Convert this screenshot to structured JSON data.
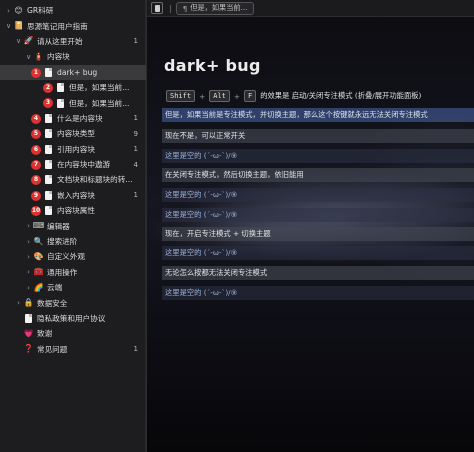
{
  "sidebar": {
    "items": [
      {
        "label": "GR科研",
        "count": "",
        "icon": "smile-emoji-icon",
        "glyph": "😊",
        "twisty": "chevron-right"
      },
      {
        "label": "思源笔记用户指南",
        "count": "",
        "icon": "book-icon",
        "glyph": "📔",
        "twisty": "chevron-down"
      },
      {
        "label": "请从这里开始",
        "count": "1",
        "icon": "rocket-icon",
        "glyph": "🚀",
        "twisty": "chevron-down"
      },
      {
        "label": "内容块",
        "count": "",
        "icon": "fire-extinguisher-icon",
        "glyph": "🧯",
        "twisty": "chevron-down"
      },
      {
        "label": "dark+ bug",
        "count": "",
        "icon": "document-icon",
        "glyph": "",
        "twisty": "chevron-down",
        "badge": "1"
      },
      {
        "label": "但是，如果当前...",
        "count": "",
        "icon": "document-icon",
        "glyph": "",
        "twisty": "",
        "badge": "2"
      },
      {
        "label": "但是，如果当前...",
        "count": "",
        "icon": "document-icon",
        "glyph": "",
        "twisty": "",
        "badge": "3"
      },
      {
        "label": "什么是内容块",
        "count": "1",
        "icon": "document-icon",
        "glyph": "",
        "twisty": "",
        "badge": "4"
      },
      {
        "label": "内容块类型",
        "count": "9",
        "icon": "document-icon",
        "glyph": "",
        "twisty": "",
        "badge": "5"
      },
      {
        "label": "引用内容块",
        "count": "1",
        "icon": "document-icon",
        "glyph": "",
        "twisty": "",
        "badge": "6"
      },
      {
        "label": "在内容块中遨游",
        "count": "4",
        "icon": "document-icon",
        "glyph": "",
        "twisty": "",
        "badge": "7"
      },
      {
        "label": "文档块和标题块的转...",
        "count": "",
        "icon": "document-icon",
        "glyph": "",
        "twisty": "",
        "badge": "8"
      },
      {
        "label": "嵌入内容块",
        "count": "1",
        "icon": "document-icon",
        "glyph": "",
        "twisty": "",
        "badge": "9"
      },
      {
        "label": "内容块属性",
        "count": "",
        "icon": "document-icon",
        "glyph": "",
        "twisty": "",
        "badge": "10"
      },
      {
        "label": "编辑器",
        "count": "",
        "icon": "keyboard-icon",
        "glyph": "⌨",
        "twisty": "chevron-right"
      },
      {
        "label": "搜索进阶",
        "count": "",
        "icon": "magnifier-icon",
        "glyph": "🔍",
        "twisty": "chevron-right"
      },
      {
        "label": "自定义外观",
        "count": "",
        "icon": "palette-icon",
        "glyph": "🎨",
        "twisty": "chevron-right"
      },
      {
        "label": "通用操作",
        "count": "",
        "icon": "toolbox-icon",
        "glyph": "🧰",
        "twisty": "chevron-right"
      },
      {
        "label": "云端",
        "count": "",
        "icon": "rainbow-icon",
        "glyph": "🌈",
        "twisty": "chevron-right"
      },
      {
        "label": "数据安全",
        "count": "",
        "icon": "lock-icon",
        "glyph": "🔒",
        "twisty": "chevron-right"
      },
      {
        "label": "隐私政策和用户协议",
        "count": "",
        "icon": "document-icon",
        "glyph": "",
        "twisty": ""
      },
      {
        "label": "致谢",
        "count": "",
        "icon": "heart-icon",
        "glyph": "💗",
        "twisty": ""
      },
      {
        "label": "常见问题",
        "count": "1",
        "icon": "question-icon",
        "glyph": "❓",
        "twisty": ""
      }
    ]
  },
  "tabbar": {
    "separator": "|",
    "tab_label": "但是，如果当前...",
    "tab_prefix": "¶"
  },
  "doc": {
    "title": "dark+  bug",
    "keys": [
      "Shift",
      "Alt",
      "F"
    ],
    "shortcut_plus": "+",
    "shortcut_text": "的效果是 启动/关闭专注模式 (折叠/展开功能面板)",
    "paragraphs": [
      "但是，如果当前是专注模式，并切换主题，那么这个按键就永远无法关闭专注模式",
      "现在不是，可以正常开关",
      "这里是空的 (´-ω-`)/⑨",
      "在关闭专注模式，然后切换主题，依旧能用",
      "这里是空的 (´-ω-`)/⑨",
      "这里是空的 (´-ω-`)/⑨",
      "现在，开启专注模式 + 切换主题",
      "这里是空的 (´-ω-`)/⑨",
      "无论怎么按都无法关闭专注模式",
      "这里是空的 (´-ω-`)/⑨"
    ]
  },
  "colors": {
    "badge": "#e03131",
    "highlight_blue": "#3a4e80",
    "highlight_grey": "#464854",
    "sidebar_bg": "#1d1d1f"
  }
}
